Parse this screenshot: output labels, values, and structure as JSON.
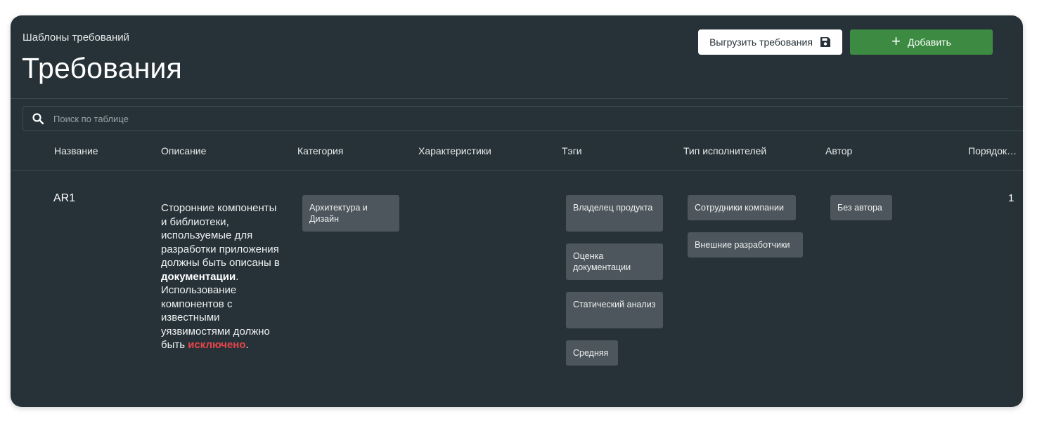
{
  "header": {
    "breadcrumb": "Шаблоны требований",
    "title": "Требования",
    "export_label": "Выгрузить требования",
    "add_label": "Добавить"
  },
  "search": {
    "placeholder": "Поиск по таблице"
  },
  "table": {
    "columns": [
      "Название",
      "Описание",
      "Категория",
      "Характеристики",
      "Тэги",
      "Тип исполнителей",
      "Автор",
      "Порядок…"
    ],
    "rows": [
      {
        "name": "AR1",
        "description": {
          "part1": "Сторонние компоненты и библиотеки, используемые для разработки приложения должны быть описаны в ",
          "bold": "документации",
          "part2": ". Использование компонентов с известными уязвимостями должно быть ",
          "red": "исключено",
          "part3": "."
        },
        "category": "Архитектура и Дизайн",
        "tags": [
          "Владелец продукта",
          "Оценка документации",
          "Статический анализ",
          "Средняя"
        ],
        "executor_types": [
          "Сотрудники компании",
          "Внешние разработчики"
        ],
        "author": "Без автора",
        "order": "1"
      }
    ]
  },
  "icons": {
    "export": "save-icon",
    "add": "plus-icon",
    "search": "search-icon"
  },
  "colors": {
    "background": "#263238",
    "accent": "#3d8b42",
    "chip": "#4c565c",
    "highlight": "#e8454a"
  }
}
